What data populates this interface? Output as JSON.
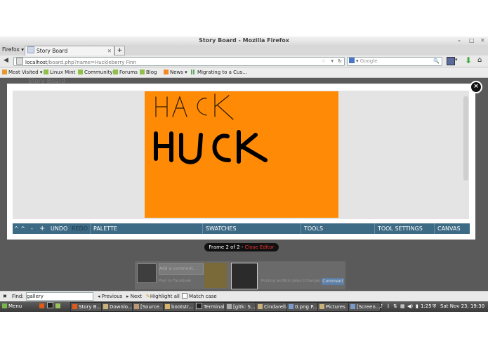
{
  "window": {
    "title": "Story Board - Mozilla Firefox"
  },
  "browser": {
    "menu_label": "Firefox ▾",
    "tab_title": "Story Board",
    "new_tab": "+",
    "url_host": "localhost",
    "url_path": "/board.php?name=Huckleberry Finn",
    "search_placeholder": "Google"
  },
  "bookmarks": [
    {
      "label": "Most Visited ▾",
      "icon": "folder-icon"
    },
    {
      "label": "Linux Mint",
      "icon": "page-icon"
    },
    {
      "label": "Community",
      "icon": "page-icon"
    },
    {
      "label": "Forums",
      "icon": "page-icon"
    },
    {
      "label": "Blog",
      "icon": "page-icon"
    },
    {
      "label": "News ▾",
      "icon": "rss-icon"
    },
    {
      "label": "Migrating to a Cus...",
      "icon": "bars-icon"
    }
  ],
  "page": {
    "heading": "Story Board"
  },
  "editor": {
    "close": "×",
    "toolbar": {
      "arrows": "^ ^",
      "minus": "-",
      "plus": "+",
      "undo": "UNDO",
      "redo": "REDO",
      "palette": "PALETTE",
      "swatches": "SWATCHES",
      "tools": "TOOLS",
      "tool_settings": "TOOL SETTINGS",
      "canvas": "CANVAS"
    },
    "drawing_text_thin": "HACK",
    "drawing_text_bold": "HUCK",
    "canvas_color": "#ff8a05"
  },
  "frame": {
    "info": "Frame 2 of 2 - ",
    "close": "Close Editor"
  },
  "comments": {
    "placeholder": "Add a comment...",
    "post_facebook": "Post to Facebook",
    "posting_as": "Posting as Nitin Jaloo (Change)",
    "button": "Comment"
  },
  "findbar": {
    "label": "Find:",
    "value": "gallery",
    "previous": "Previous",
    "next": "Next",
    "highlight": "Highlight all",
    "match_case": "Match case"
  },
  "taskbar": {
    "menu": "Menu",
    "items": [
      "Story B...",
      "Downlo...",
      "[Source...",
      "bootstr...",
      "Terminal",
      "[gitk: S...",
      "Cindarella",
      "0.png P...",
      "Pictures",
      "[Screen..."
    ],
    "clock": "1:25",
    "date": "Sat Nov 23, 19:30"
  }
}
